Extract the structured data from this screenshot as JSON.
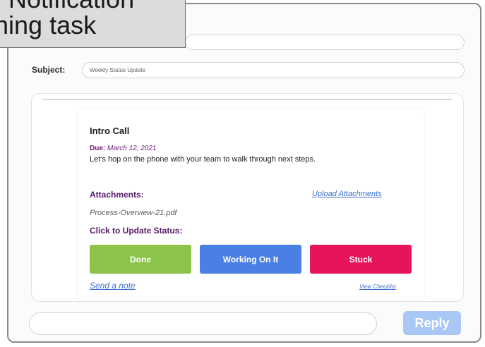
{
  "overlay": {
    "line1": "Notification",
    "line2": "ning task"
  },
  "compose": {
    "to_value": "",
    "subject_label": "Subject:",
    "subject_value": "Weekly Status Update"
  },
  "card": {
    "title": "Intro Call",
    "due_label": "Due:",
    "due_date": "March 12, 2021",
    "description": "Let's hop on the phone with your team to walk through next steps.",
    "attachments_label": "Attachments:",
    "upload_link": "Upload Attachments",
    "file_name": "Process-Overview-21.pdf",
    "status_label": "Click to Update Status:",
    "buttons": {
      "done": "Done",
      "working": "Working On It",
      "stuck": "Stuck"
    },
    "send_note": "Send a note",
    "view_checklist": "View Checklist"
  },
  "reply": {
    "input_value": "",
    "button_label": "Reply"
  },
  "colors": {
    "done": "#8cc34a",
    "working": "#4a7fe3",
    "stuck": "#e8145a",
    "reply_button": "#a9c7f5",
    "accent_purple": "#5a1a6b",
    "link_blue": "#3a6fd0"
  }
}
